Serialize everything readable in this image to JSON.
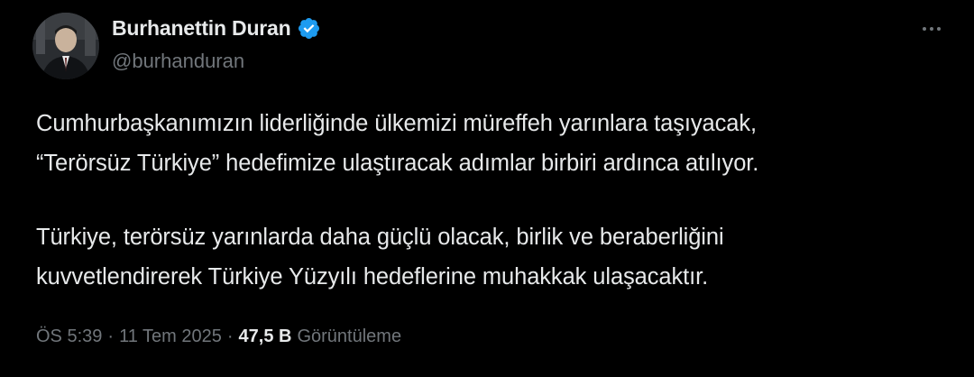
{
  "tweet": {
    "author": {
      "display_name": "Burhanettin Duran",
      "handle": "@burhanduran",
      "verified_icon": "verified-badge-icon",
      "verified_color": "#1d9bf0"
    },
    "more_icon": "more-options-icon",
    "paragraphs": [
      {
        "lines": [
          "Cumhurbaşkanımızın liderliğinde ülkemizi müreffeh yarınlara taşıyacak,",
          "“Terörsüz Türkiye” hedefimize ulaştıracak adımlar birbiri ardınca atılıyor."
        ]
      },
      {
        "lines": [
          "Türkiye, terörsüz yarınlarda daha güçlü olacak, birlik ve beraberliğini",
          "kuvvetlendirerek Türkiye Yüzyılı hedeflerine muhakkak ulaşacaktır."
        ]
      }
    ],
    "meta": {
      "time": "ÖS 5:39",
      "separator": "·",
      "date": "11 Tem 2025",
      "views_count": "47,5 B",
      "views_label": "Görüntüleme"
    },
    "colors": {
      "background": "#000000",
      "text": "#e7e9ea",
      "secondary_text": "#71767b"
    }
  }
}
